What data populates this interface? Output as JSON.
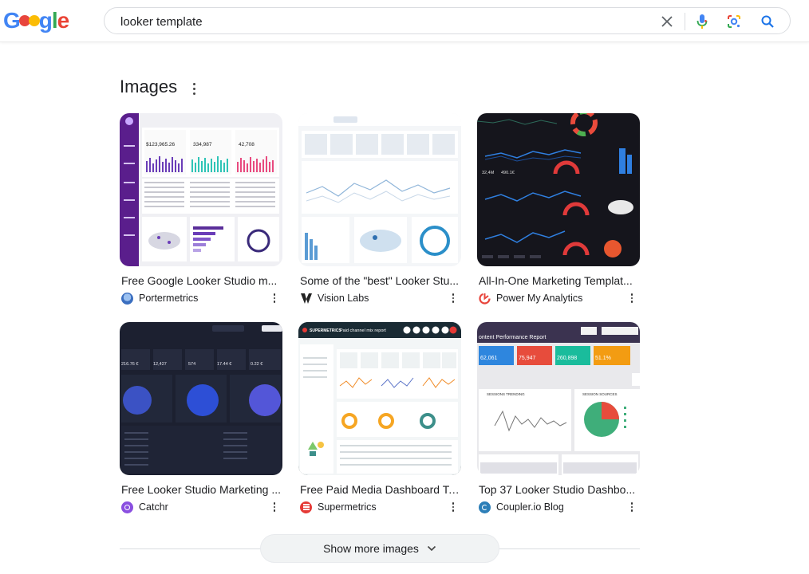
{
  "search": {
    "query": "looker template"
  },
  "logo": {
    "text": "Google"
  },
  "section": {
    "title": "Images"
  },
  "results": [
    {
      "title": "Free Google Looker Studio m...",
      "source": "Portermetrics",
      "favicon_color": "#5b8dd6"
    },
    {
      "title": "Some of the \"best\" Looker Stu...",
      "source": "Vision Labs",
      "favicon_color": "#1a1a1a"
    },
    {
      "title": "All-In-One Marketing Templat...",
      "source": "Power My Analytics",
      "favicon_color": "#e8453c"
    },
    {
      "title": "Free Looker Studio Marketing ...",
      "source": "Catchr",
      "favicon_color": "#8a4fe0"
    },
    {
      "title": "Free Paid Media Dashboard Te...",
      "source": "Supermetrics",
      "favicon_color": "#e53935"
    },
    {
      "title": "Top 37 Looker Studio Dashbo...",
      "source": "Coupler.io Blog",
      "favicon_color": "#2d7fb8"
    }
  ],
  "thumb_text": {
    "t1_val1": "$123,965.26",
    "t1_val2": "334,987",
    "t1_val3": "42,708",
    "t3_val1": "32,4M",
    "t3_val2": "490.1€",
    "t4_val1": "216.76 €",
    "t4_val2": "12,427",
    "t4_val3": "574",
    "t4_val4": "17.44 €",
    "t4_val5": "0.22 €",
    "t5_brand": "SUPERMETRICS",
    "t5_title": "Paid channel mix report",
    "t6_title": "ontent Performance Report",
    "t6_v1": "62,061",
    "t6_v2": "75,947",
    "t6_v3": "260,898",
    "t6_v4": "51.1%",
    "t6_l1": "SESSIONS TRENDING",
    "t6_l2": "SESSION SOURCES"
  },
  "show_more": {
    "label": "Show more images"
  },
  "colors": {
    "accent_blue": "#1a73e8",
    "border": "#dadce0"
  }
}
